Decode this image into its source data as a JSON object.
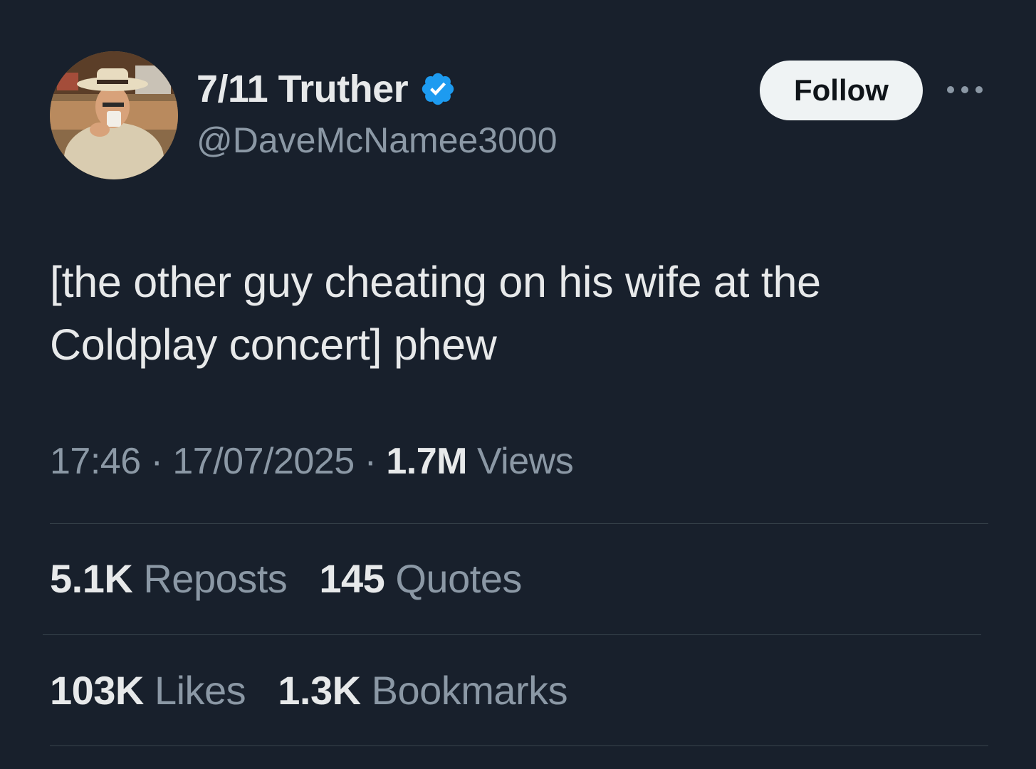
{
  "user": {
    "display_name": "7/11 Truther",
    "handle": "@DaveMcNamee3000",
    "verified": true,
    "verified_color": "#1d9bf0"
  },
  "actions": {
    "follow_label": "Follow",
    "more_icon": "more-horizontal-icon"
  },
  "tweet": {
    "text": "[the other guy cheating on his wife at the Coldplay concert] phew",
    "time": "17:46",
    "separator": "·",
    "date": "17/07/2025",
    "views_count": "1.7M",
    "views_label": "Views"
  },
  "stats": {
    "reposts_count": "5.1K",
    "reposts_label": "Reposts",
    "quotes_count": "145",
    "quotes_label": "Quotes",
    "likes_count": "103K",
    "likes_label": "Likes",
    "bookmarks_count": "1.3K",
    "bookmarks_label": "Bookmarks"
  },
  "theme": {
    "background": "#18202c",
    "text_primary": "#e7e9ea",
    "text_secondary": "#8b98a5",
    "divider": "#38444d"
  }
}
